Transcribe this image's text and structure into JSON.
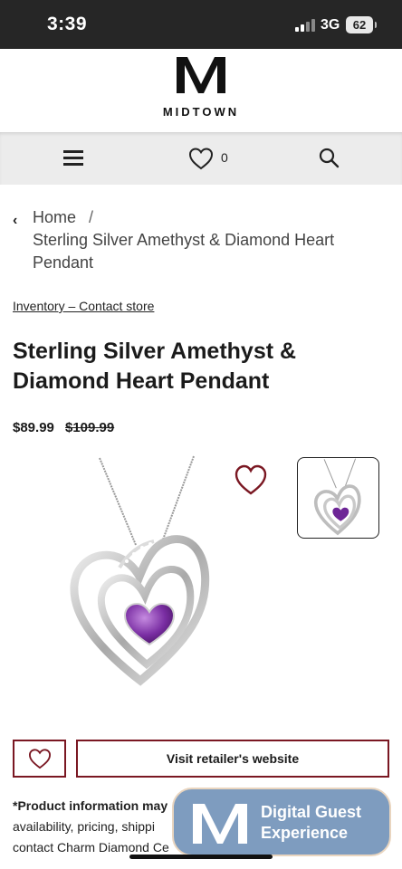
{
  "status_bar": {
    "time": "3:39",
    "network": "3G",
    "battery": "62"
  },
  "brand": {
    "name": "MIDTOWN",
    "logo_letter": "M"
  },
  "nav": {
    "wishlist_count": "0"
  },
  "breadcrumb": {
    "home": "Home",
    "separator": "/",
    "current": "Sterling Silver Amethyst & Diamond Heart Pendant"
  },
  "inventory_link": "Inventory – Contact store",
  "product": {
    "title": "Sterling Silver Amethyst & Diamond Heart Pendant",
    "price": "$89.99",
    "original_price": "$109.99"
  },
  "actions": {
    "visit_label": "Visit retailer's website"
  },
  "disclaimer": {
    "bold": "*Product information may",
    "line2": "availability, pricing, shippi",
    "line3": "contact Charm Diamond Ce"
  },
  "guest_badge": {
    "line1": "Digital Guest",
    "line2": "Experience"
  },
  "colors": {
    "accent": "#7a1722",
    "status_bar": "#262626",
    "navbar": "#ececec",
    "badge": "#7e9cbf"
  },
  "icons": [
    "menu-icon",
    "heart-icon",
    "search-icon",
    "chevron-left-icon"
  ]
}
